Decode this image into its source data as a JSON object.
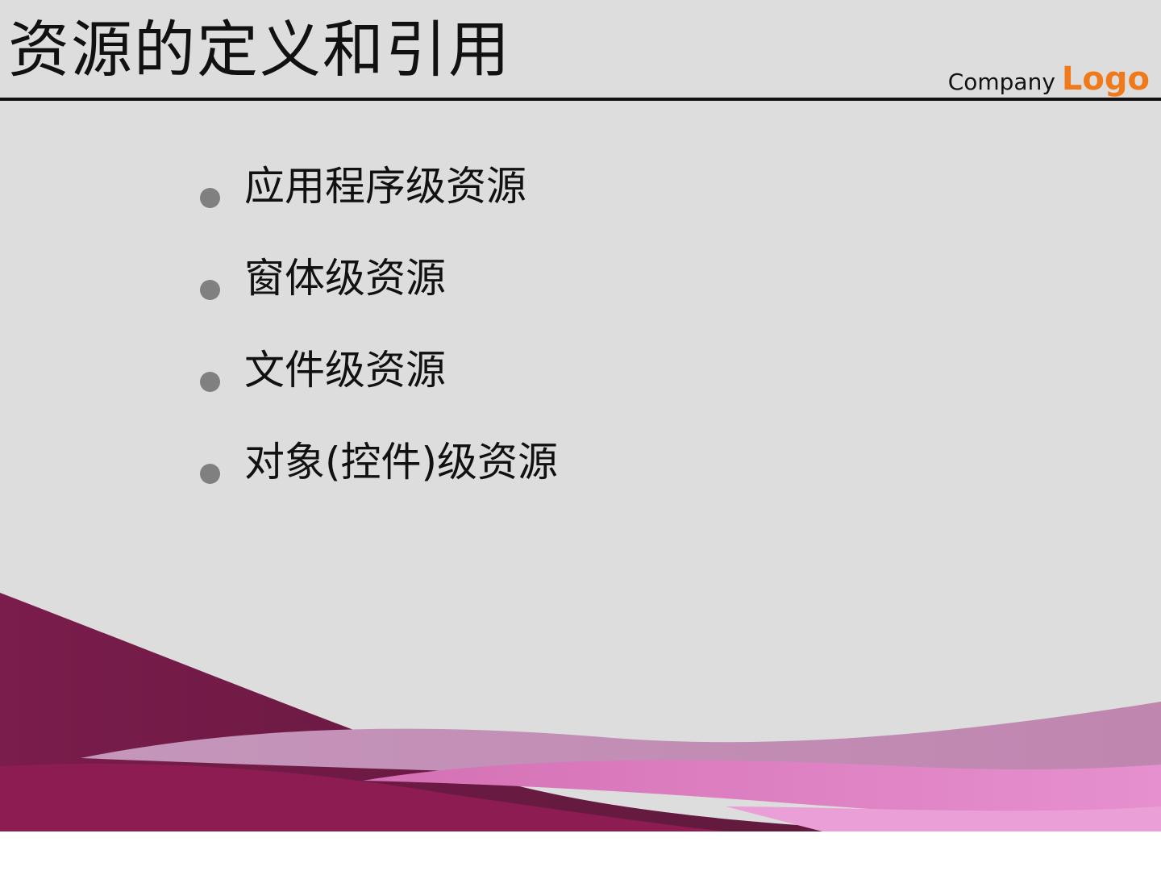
{
  "slide": {
    "title": "资源的定义和引用",
    "logo": {
      "company": "Company",
      "word": "Logo",
      "word_color": "#f07a1a"
    },
    "bullets": [
      {
        "text": "应用程序级资源"
      },
      {
        "text": "窗体级资源"
      },
      {
        "text": "文件级资源"
      },
      {
        "text": "对象(控件)级资源"
      }
    ]
  },
  "colors": {
    "background": "#dddddd",
    "title_rule": "#111111",
    "bullet_dot": "#808080",
    "wave_dark": "#6e1a45",
    "wave_mid": "#8c1c52",
    "wave_light": "#c290b5",
    "wave_pink": "#e07ec0"
  }
}
